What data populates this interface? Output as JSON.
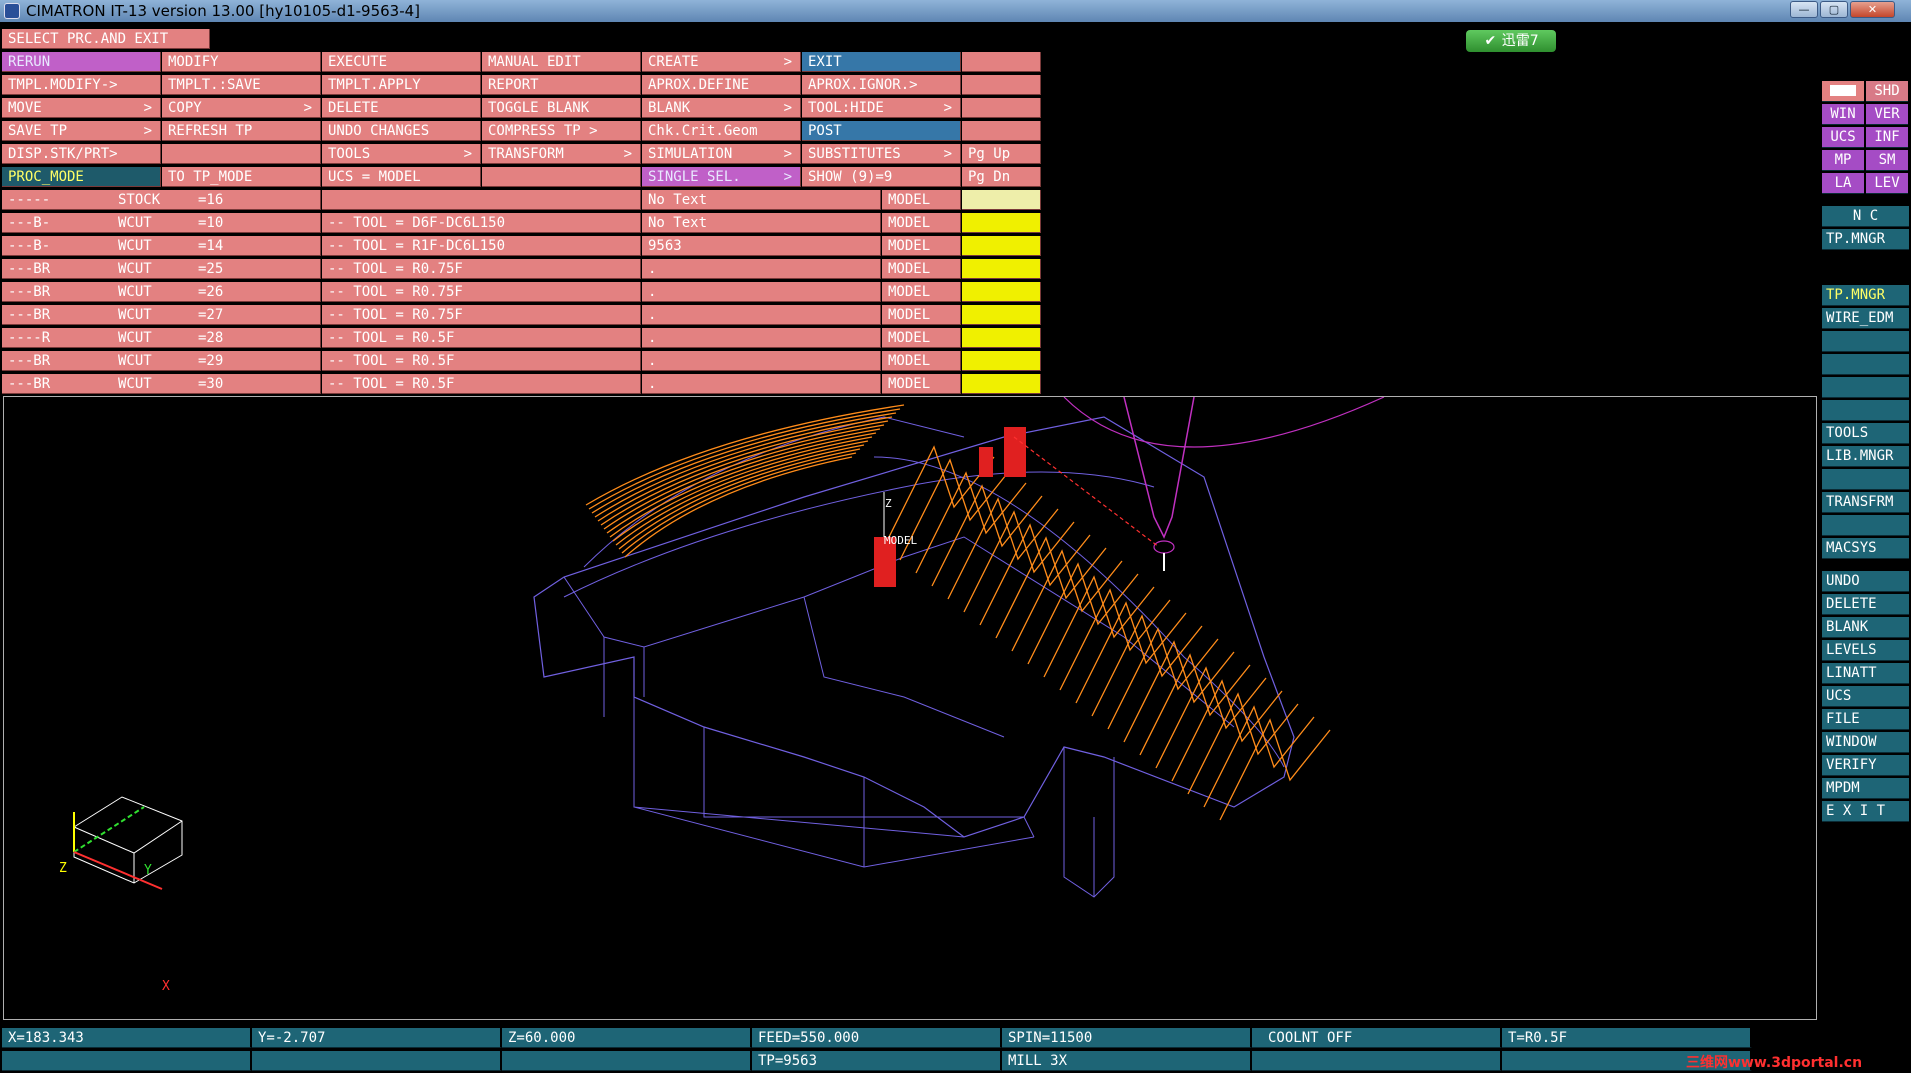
{
  "window": {
    "title": "CIMATRON IT-13 version 13.00 [hy10105-d1-9563-4]",
    "min": "—",
    "max": "▢",
    "close": "✕"
  },
  "badge": {
    "label": "迅雷7",
    "icon": "✔"
  },
  "prompt": "SELECT PRC.AND EXIT",
  "menu": {
    "rerun": "RERUN",
    "modify": "MODIFY",
    "execute": "EXECUTE",
    "manual_edit": "MANUAL EDIT",
    "create": "CREATE",
    "exit": "EXIT",
    "tmpl_modify": "TMPL.MODIFY->",
    "tmplt_save": "TMPLT.:SAVE",
    "tmplt_apply": "TMPLT.APPLY",
    "report": "REPORT",
    "aprox_define": "APROX.DEFINE",
    "aprox_ignor": "APROX.IGNOR.>",
    "move": "MOVE",
    "copy": "COPY",
    "delete": "DELETE",
    "toggle_blank": "TOGGLE BLANK",
    "blank": "BLANK",
    "tool_hide": "TOOL:HIDE",
    "save_tp": "SAVE TP",
    "refresh_tp": "REFRESH TP",
    "undo_changes": "UNDO CHANGES",
    "compress_tp": "COMPRESS TP >",
    "chk_crit": "Chk.Crit.Geom",
    "post": "POST",
    "disp_stk": "DISP.STK/PRT>",
    "tools": "TOOLS",
    "transform": "TRANSFORM",
    "simulation": "SIMULATION",
    "substitutes": "SUBSTITUTES",
    "pg_up": "Pg Up",
    "proc_mode": "PROC_MODE",
    "to_tp_mode": "TO TP_MODE",
    "ucs_model": "UCS = MODEL",
    "single_sel": "SINGLE SEL.",
    "show": "SHOW (9)=9",
    "pg_dn": "Pg Dn",
    "arrow": ">"
  },
  "procedures": [
    {
      "flag": "-----",
      "type": "STOCK",
      "num": "=16",
      "tool": "",
      "text": "No Text",
      "model": "MODEL"
    },
    {
      "flag": "---B-",
      "type": "WCUT",
      "num": "=10",
      "tool": "-- TOOL = D6F-DC6L150",
      "text": "No Text",
      "model": "MODEL"
    },
    {
      "flag": "---B-",
      "type": "WCUT",
      "num": "=14",
      "tool": "-- TOOL = R1F-DC6L150",
      "text": "9563",
      "model": "MODEL"
    },
    {
      "flag": "---BR",
      "type": "WCUT",
      "num": "=25",
      "tool": "-- TOOL = R0.75F",
      "text": ".",
      "model": "MODEL"
    },
    {
      "flag": "---BR",
      "type": "WCUT",
      "num": "=26",
      "tool": "-- TOOL = R0.75F",
      "text": ".",
      "model": "MODEL"
    },
    {
      "flag": "---BR",
      "type": "WCUT",
      "num": "=27",
      "tool": "-- TOOL = R0.75F",
      "text": ".",
      "model": "MODEL"
    },
    {
      "flag": "----R",
      "type": "WCUT",
      "num": "=28",
      "tool": "-- TOOL = R0.5F",
      "text": ".",
      "model": "MODEL"
    },
    {
      "flag": "---BR",
      "type": "WCUT",
      "num": "=29",
      "tool": "-- TOOL = R0.5F",
      "text": ".",
      "model": "MODEL"
    },
    {
      "flag": "---BR",
      "type": "WCUT",
      "num": "=30",
      "tool": "-- TOOL = R0.5F",
      "text": ".",
      "model": "MODEL"
    }
  ],
  "viewport": {
    "axis_z": "Z",
    "axis_y": "Y",
    "axis_x": "X",
    "model_label": "MODEL",
    "tool_path_color": "#ff8c1a",
    "wire_color": "#7060e0",
    "tool_color": "#c030c0"
  },
  "right_panel": {
    "shd": "SHD",
    "win": "WIN",
    "ver": "VER",
    "ucs": "UCS",
    "inf": "INF",
    "mp": "MP",
    "sm": "SM",
    "la": "LA",
    "lev": "LEV",
    "nc": "N C",
    "tp_mngr": "TP.MNGR",
    "tp_mngr_active": "TP.MNGR",
    "wire_edm": "WIRE_EDM",
    "tools": "TOOLS",
    "lib_mngr": "LIB.MNGR",
    "transfrm": "TRANSFRM",
    "macsys": "MACSYS",
    "undo": "UNDO",
    "delete": "DELETE",
    "blank": "BLANK",
    "levels": "LEVELS",
    "linatt": "LINATT",
    "ucs2": "UCS",
    "file": "FILE",
    "window": "WINDOW",
    "verify": "VERIFY",
    "mpdm": "MPDM",
    "exit": "E X I T"
  },
  "status": {
    "x": "X=183.343",
    "y": "Y=-2.707",
    "z": "Z=60.000",
    "feed": "FEED=550.000",
    "spin": "SPIN=11500",
    "coolnt": "COOLNT OFF",
    "tool": "T=R0.5F",
    "tp": "TP=9563",
    "mill": "MILL 3X"
  },
  "watermark": "三维网www.3dportal.cn"
}
